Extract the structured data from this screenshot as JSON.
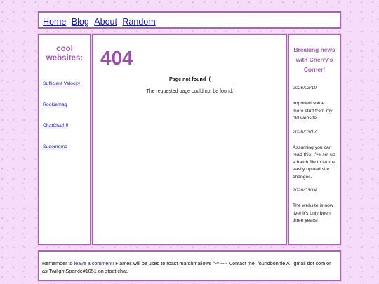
{
  "nav": {
    "links": [
      "Home",
      "Blog",
      "About",
      "Random"
    ]
  },
  "left": {
    "title": "cool websites:",
    "links": [
      "Sufficient Velocity",
      "Rookiemag",
      "ChatChat!!!!",
      "Sudomemo"
    ]
  },
  "main": {
    "code": "404",
    "title": "Page not found :(",
    "message": "The requested page could not be found."
  },
  "news": {
    "title": "Breaking news with Cherry's Corner!",
    "items": [
      {
        "date": "2026/03/19",
        "body": "Imported some more stuff from my old website."
      },
      {
        "date": "2026/03/17",
        "body": "Assuming you can read this, I've set up a batch file to let me easily upload site changes."
      },
      {
        "date": "2026/03/14",
        "body": "The website is now live! It's only been three years!"
      }
    ]
  },
  "footer": {
    "text_before": "Remember to ",
    "link": "leave a comment!",
    "text_after": " Flames will be used to roast marshmallows ^-^ ---- Contact me: foundbonnie AT gmail dot com or as TwilightSparkle#1051 on stoat.chat."
  },
  "colors": {
    "background": "#f6dcf8",
    "border": "#a566b1",
    "accent": "#9b4ea7",
    "link": "#1a1aa6"
  }
}
